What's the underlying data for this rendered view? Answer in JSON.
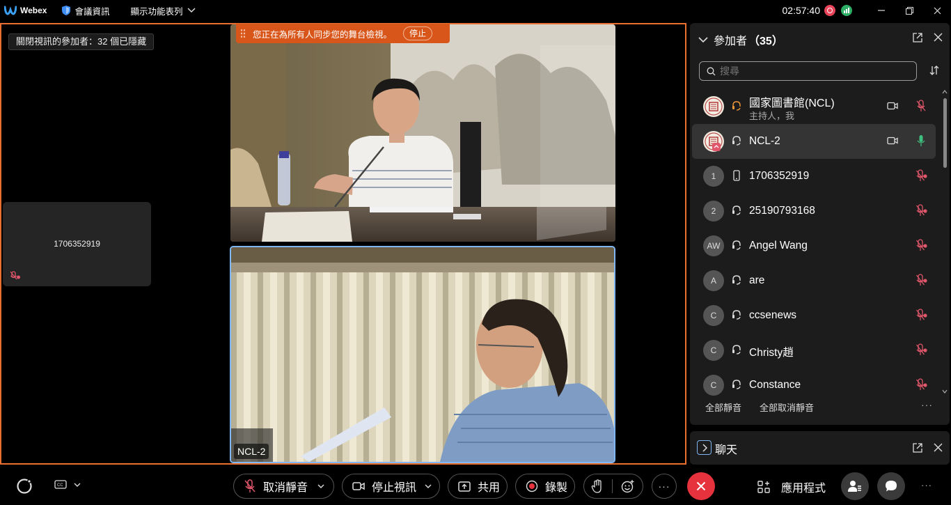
{
  "topbar": {
    "app_name": "Webex",
    "meeting_info": "會議資訊",
    "show_menu": "顯示功能表列",
    "clock": "02:57:40"
  },
  "stage": {
    "hidden_note": "關閉視訊的參加者：32 個已隱藏",
    "sync_banner": "您正在為所有人同步您的舞台檢視。",
    "stop_label": "停止",
    "small_tile_name": "1706352919",
    "bottom_video_label": "NCL-2"
  },
  "participants": {
    "title": "參加者",
    "count_text": "（35）",
    "search_placeholder": "搜尋",
    "items": [
      {
        "avatar": "",
        "name": "國家圖書館(NCL)",
        "sub": "主持人，我",
        "conn": "headset-host"
      },
      {
        "avatar": "",
        "name": "NCL-2",
        "sub": "",
        "conn": "headset"
      },
      {
        "avatar": "1",
        "name": "1706352919",
        "sub": "",
        "conn": "phone"
      },
      {
        "avatar": "2",
        "name": "25190793168",
        "sub": "",
        "conn": "headset"
      },
      {
        "avatar": "AW",
        "name": "Angel Wang",
        "sub": "",
        "conn": "headset"
      },
      {
        "avatar": "A",
        "name": "are",
        "sub": "",
        "conn": "headset"
      },
      {
        "avatar": "C",
        "name": "ccsenews",
        "sub": "",
        "conn": "headset"
      },
      {
        "avatar": "C",
        "name": "Christy趙",
        "sub": "",
        "conn": "headset"
      },
      {
        "avatar": "C",
        "name": "Constance",
        "sub": "",
        "conn": "headset"
      }
    ],
    "mute_all": "全部靜音",
    "unmute_all": "全部取消靜音",
    "more": "···"
  },
  "chat": {
    "title": "聊天"
  },
  "controls": {
    "unmute": "取消靜音",
    "stop_video": "停止視訊",
    "share": "共用",
    "record": "錄製",
    "more": "···",
    "apps": "應用程式",
    "overflow": "···"
  },
  "colors": {
    "accent_orange": "#e86f2f",
    "banner_orange": "#d9561b",
    "end_red": "#e5323d",
    "mute_red": "#e0566a",
    "active_green": "#3fbf7f",
    "focus_blue": "#7fb6f3"
  }
}
